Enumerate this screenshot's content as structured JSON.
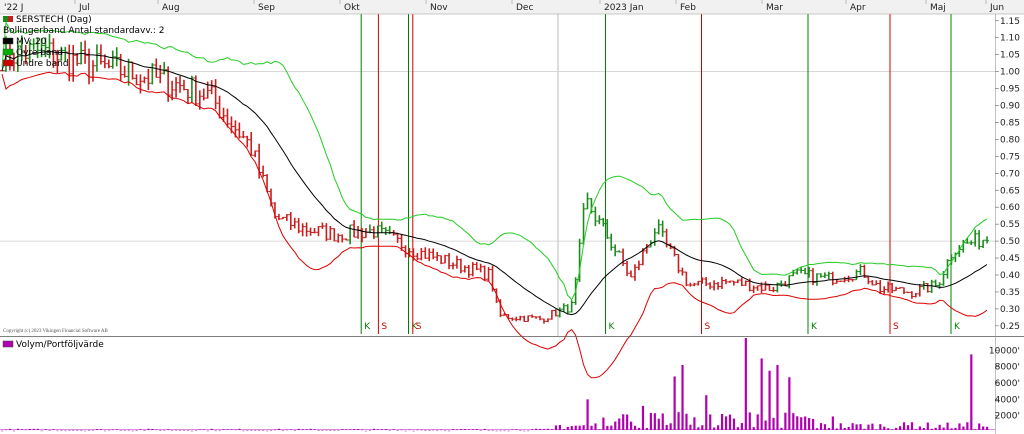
{
  "chart_data": [
    {
      "type": "ohlc",
      "legend": [
        {
          "label": "SERSTECH (Dag)",
          "swatch": "green-red"
        },
        {
          "label": "Bollingerband  Antal standardavv.: 2",
          "swatch": "none"
        },
        {
          "label": "MV: 20",
          "swatch": "#000000"
        },
        {
          "label": "Övre band",
          "swatch": "#00b000"
        },
        {
          "label": "Undre band",
          "swatch": "#d00000"
        }
      ],
      "months": [
        "'22 J",
        "Jul",
        "Aug",
        "Sep",
        "Okt",
        "Nov",
        "Dec",
        "2023 Jan",
        "Feb",
        "Mar",
        "Apr",
        "Maj",
        "Jun"
      ],
      "y_ticks": [
        "1.15",
        "1.10",
        "1.05",
        "1.00",
        "0.95",
        "0.90",
        "0.85",
        "0.80",
        "0.75",
        "0.70",
        "0.65",
        "0.60",
        "0.55",
        "0.50",
        "0.45",
        "0.40",
        "0.35",
        "0.30",
        "0.25"
      ],
      "ylim": [
        0.22,
        1.17
      ],
      "reference_lines": [
        1.0,
        0.5
      ],
      "signals": [
        {
          "label": "K",
          "month_pos": 4.2,
          "color": "#008000"
        },
        {
          "label": "S",
          "month_pos": 4.4,
          "color": "#d00000"
        },
        {
          "label": "K",
          "month_pos": 4.75,
          "color": "#008000"
        },
        {
          "label": "S",
          "month_pos": 4.8,
          "color": "#d00000"
        },
        {
          "label": "K",
          "month_pos": 7.02,
          "color": "#008000"
        },
        {
          "label": "S",
          "month_pos": 8.25,
          "color": "#d00000"
        },
        {
          "label": "K",
          "month_pos": 9.5,
          "color": "#008000"
        },
        {
          "label": "S",
          "month_pos": 10.5,
          "color": "#d00000"
        },
        {
          "label": "K",
          "month_pos": 11.35,
          "color": "#008000"
        }
      ],
      "price_path": [
        [
          0,
          1.05
        ],
        [
          0.5,
          1.06
        ],
        [
          1,
          1.02
        ],
        [
          1.5,
          1.0
        ],
        [
          2,
          0.97
        ],
        [
          2.5,
          0.93
        ],
        [
          3,
          0.78
        ],
        [
          3.3,
          0.57
        ],
        [
          3.6,
          0.54
        ],
        [
          4,
          0.52
        ],
        [
          4.5,
          0.53
        ],
        [
          5,
          0.47
        ],
        [
          5.5,
          0.43
        ],
        [
          5.9,
          0.4
        ],
        [
          6,
          0.28
        ],
        [
          6.5,
          0.27
        ],
        [
          6.9,
          0.31
        ],
        [
          7.05,
          0.62
        ],
        [
          7.3,
          0.52
        ],
        [
          7.6,
          0.39
        ],
        [
          7.9,
          0.54
        ],
        [
          8.3,
          0.37
        ],
        [
          8.8,
          0.38
        ],
        [
          9.3,
          0.36
        ],
        [
          9.6,
          0.4
        ],
        [
          10,
          0.39
        ],
        [
          10.4,
          0.41
        ],
        [
          10.6,
          0.36
        ],
        [
          11,
          0.35
        ],
        [
          11.3,
          0.37
        ],
        [
          11.5,
          0.48
        ],
        [
          11.9,
          0.51
        ]
      ],
      "copyright": "Copyright (c) 2023 Vikingen Financial Software AB"
    },
    {
      "type": "bar",
      "legend": [
        {
          "label": "Volym/Portföljvärde",
          "swatch": "#b000b0"
        }
      ],
      "y_ticks": [
        "10000'",
        "8000'",
        "6000'",
        "4000'",
        "2000'"
      ],
      "ylim": [
        0,
        11500
      ],
      "color": "#b000b0"
    }
  ]
}
